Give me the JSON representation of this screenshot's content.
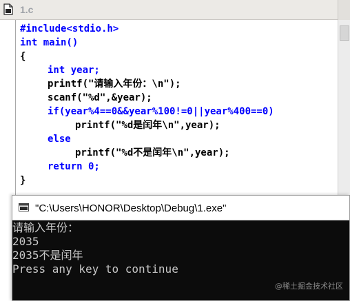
{
  "editor": {
    "tab_title": "1.c",
    "code_lines": [
      "#include<stdio.h>",
      "int main()",
      "{",
      "int year;",
      "printf(\"请输入年份：\\n\");",
      "scanf(\"%d\",&year);",
      "if(year%4==0&&year%100!=0||year%400==0)",
      "printf(\"%d是闰年\\n\",year);",
      "else",
      "printf(\"%d不是闰年\\n\",year);",
      "return 0;",
      "}"
    ]
  },
  "console": {
    "title": "\"C:\\Users\\HONOR\\Desktop\\Debug\\1.exe\"",
    "output_lines": [
      "请输入年份：",
      "2035",
      "2035不是闰年",
      "Press any key to continue"
    ],
    "watermark": "@稀土掘金技术社区"
  },
  "colors": {
    "keyword": "#0000ff",
    "code_text": "#000000",
    "console_bg": "#0c0c0c",
    "console_text": "#c8c8c8"
  },
  "icons": {
    "editor_file": "document-icon",
    "console_window": "console-window-icon"
  }
}
